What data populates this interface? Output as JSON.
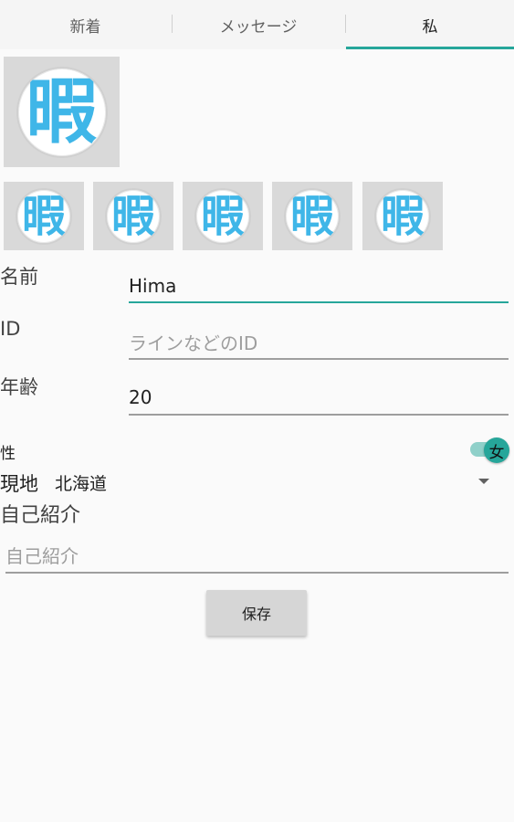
{
  "tabs": [
    {
      "label": "新着"
    },
    {
      "label": "メッセージ"
    },
    {
      "label": "私"
    }
  ],
  "avatar": {
    "main_glyph": "暇",
    "thumbnails": [
      "暇",
      "暇",
      "暇",
      "暇",
      "暇"
    ]
  },
  "form": {
    "name_label": "名前",
    "name_value": "Hima",
    "id_label": "ID",
    "id_placeholder": "ラインなどのID",
    "age_label": "年齢",
    "age_value": "20",
    "gender_label": "性",
    "gender_switch_text": "女",
    "location_label": "現地",
    "location_value": "北海道",
    "intro_title": "自己紹介",
    "intro_placeholder": "自己紹介",
    "save_label": "保存"
  },
  "colors": {
    "accent": "#26a69a",
    "avatar_text": "#3fb6e8"
  }
}
